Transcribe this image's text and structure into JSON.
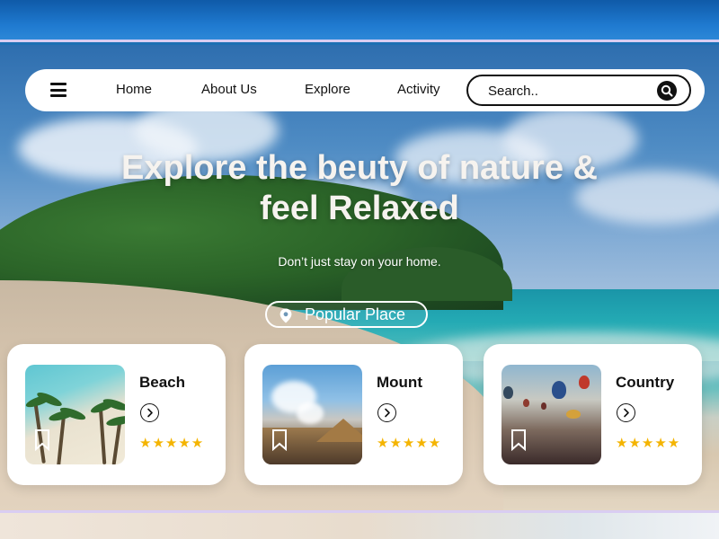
{
  "nav": {
    "items": [
      {
        "label": "Home"
      },
      {
        "label": "About Us"
      },
      {
        "label": "Explore"
      },
      {
        "label": "Activity"
      }
    ],
    "search": {
      "placeholder": "Search.."
    }
  },
  "hero": {
    "headline_line1": "Explore the beuty of nature &",
    "headline_line2": "feel Relaxed",
    "subtitle": "Don’t just stay on your home.",
    "popular_button": "Popular Place"
  },
  "cards": [
    {
      "title": "Beach",
      "rating": 5,
      "stars": "★★★★★",
      "image": "beach-palms"
    },
    {
      "title": "Mount",
      "rating": 5,
      "stars": "★★★★★",
      "image": "volcano-mountain"
    },
    {
      "title": "Country",
      "rating": 5,
      "stars": "★★★★★",
      "image": "hot-air-balloons"
    }
  ],
  "colors": {
    "star": "#f4b400",
    "card_bg": "#ffffff",
    "nav_bg": "#ffffff",
    "text_dark": "#111111",
    "hero_text": "#f6f3ef",
    "band_accent": "#d9cdf2"
  }
}
